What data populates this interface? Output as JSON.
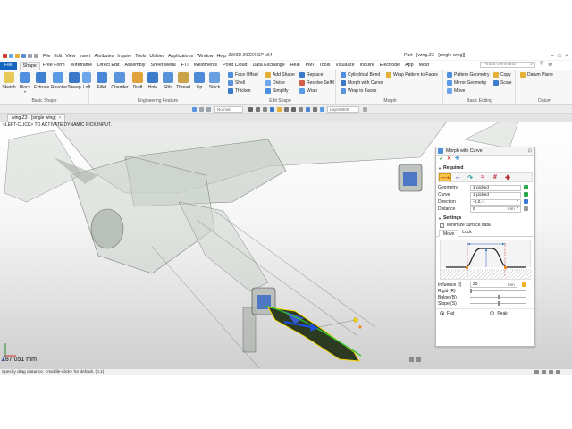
{
  "titlebar": {
    "menu": [
      "File",
      "Edit",
      "View",
      "Insert",
      "Attributes",
      "Inquire",
      "Tools",
      "Utilities",
      "Applications",
      "Window",
      "Help"
    ],
    "app_title": "ZW3D 2022X SP x64",
    "doc_title": "Part - [wing.Z3 - [single wing]]"
  },
  "tabs": [
    "File",
    "Shape",
    "Free Form",
    "Wireframe",
    "Direct Edit",
    "Assembly",
    "Sheet Metal",
    "FTI",
    "Weldments",
    "Point Cloud",
    "Data Exchange",
    "Heal",
    "PMI",
    "Tools",
    "Visualize",
    "Inquire",
    "Electrode",
    "App",
    "Mold"
  ],
  "active_tab": "Shape",
  "search": {
    "placeholder": "Find a command"
  },
  "ribbon": {
    "basic_shape": {
      "title": "Basic Shape",
      "buttons": [
        "Sketch",
        "Block",
        "Extrude",
        "Revolve",
        "Sweep",
        "Loft"
      ]
    },
    "engineering_feature": {
      "title": "Engineering Feature",
      "buttons": [
        "Fillet",
        "Chamfer",
        "Draft",
        "Hole",
        "Rib",
        "Thread",
        "Lip",
        "Stock"
      ]
    },
    "edit_shape": {
      "title": "Edit Shape",
      "items": [
        "Face Offset",
        "Add Shape",
        "Replace",
        "Shell",
        "Divide",
        "Resolve SelfX",
        "Thicken",
        "Simplify",
        "Wrap"
      ]
    },
    "morph": {
      "title": "Morph",
      "items": [
        "Cylindrical Bend",
        "Wrap Pattern to Faces",
        "Morph with Curve",
        "Wrap to Faces"
      ]
    },
    "basic_editing": {
      "title": "Basic Editing",
      "items": [
        "Pattern Geometry",
        "Copy",
        "Mirror Geometry",
        "Scale",
        "Move"
      ]
    },
    "datum": {
      "title": "Datum",
      "items": [
        "Datum Plane"
      ]
    }
  },
  "toolbar": {
    "render_mode": "Normal",
    "layer": "Layer0000"
  },
  "doc_tab": {
    "label": "wing.Z3 - [single wing]"
  },
  "viewport": {
    "hint": "<LEFT-CLICK> TO ACTIVATE DYNAMIC PICK INPUT.",
    "distance": "187.051 mm"
  },
  "status": {
    "text": "Specify drag distance. <middle-click> for default. (0.1)"
  },
  "panel": {
    "title": "Morph with Curve",
    "required_label": "Required",
    "fields": [
      {
        "label": "Geometry",
        "value": "1 picked"
      },
      {
        "label": "Curve",
        "value": "1 picked"
      },
      {
        "label": "Direction",
        "value": "-0,0,-1"
      },
      {
        "label": "Distance",
        "value": "5",
        "unit": "mm"
      }
    ],
    "settings_label": "Settings",
    "minimize_label": "Minimize surface data",
    "subtabs": [
      "Move",
      "Lock"
    ],
    "influence": {
      "label": "Influence (I)",
      "value": "20",
      "unit": "mm"
    },
    "sliders": [
      {
        "label": "Rigid (R)",
        "value": 0.0
      },
      {
        "label": "Bulge (B)",
        "value": 0.5
      },
      {
        "label": "Slope (S)",
        "value": 0.5
      }
    ],
    "radios": [
      "Flat",
      "Peak"
    ],
    "radio_selected": "Flat"
  },
  "colors": {
    "accent": "#1565c0",
    "selected_mode": "#f7c648",
    "highlight": "#f5d300"
  }
}
